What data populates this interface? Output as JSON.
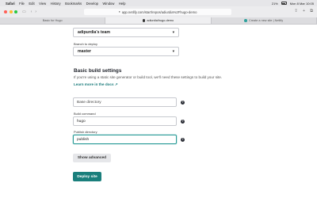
{
  "menubar": {
    "items": [
      "Safari",
      "File",
      "Edit",
      "View",
      "History",
      "Bookmarks",
      "Develop",
      "Window",
      "Help"
    ],
    "status": "21%",
    "date_time": "Mon 8 Mar 10:05"
  },
  "browser": {
    "url": "app.netlify.com/start/repos/adiurdia%2Fhugo-demo",
    "tabs": [
      {
        "label": "Basic for Hugo",
        "active": false
      },
      {
        "label": "adiurdia/hugo-demo",
        "active": true
      },
      {
        "label": "Create a new site | Netlify",
        "active": false
      }
    ]
  },
  "form": {
    "owner_value": "adipurdia's team",
    "branch_label": "Branch to deploy",
    "branch_value": "master",
    "section_title": "Basic build settings",
    "section_desc": "If you're using a static site generator or build tool, we'll need these settings to build your site.",
    "learn_more": "Learn more in the docs ↗",
    "base_dir_placeholder": "Base directory",
    "build_command_label": "Build command",
    "build_command_value": "hugo",
    "publish_dir_label": "Publish directory",
    "publish_dir_value": "publish",
    "show_advanced": "Show advanced",
    "deploy": "Deploy site"
  },
  "colors": {
    "accent": "#1a7f7c",
    "link": "#1b7c7c",
    "focus": "#2b9c98"
  }
}
